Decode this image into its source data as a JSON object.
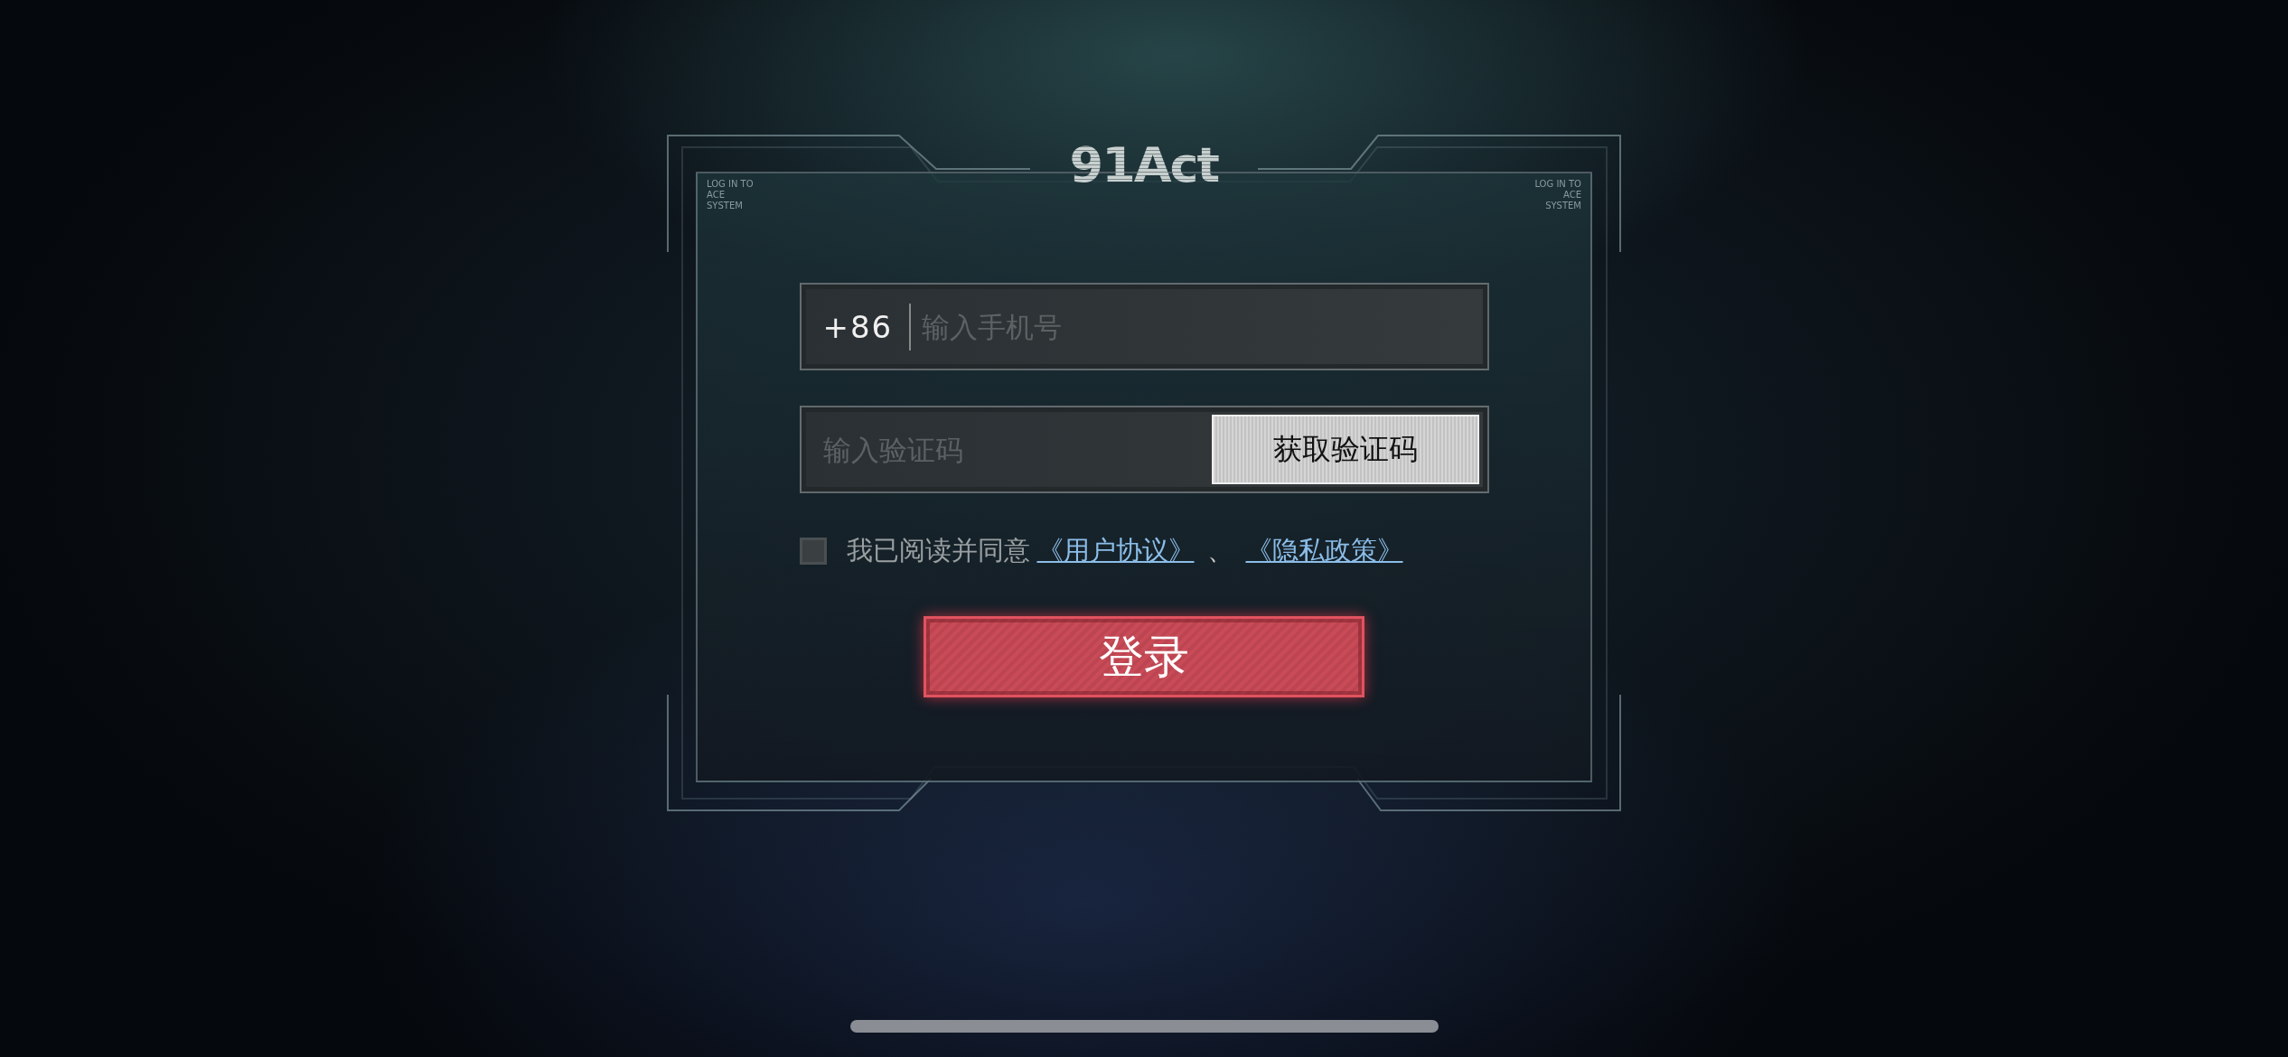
{
  "logo": "91Act",
  "corner_captions": [
    [
      "LOG IN TO",
      "ACE",
      "SYSTEM"
    ],
    [
      "LOG IN TO",
      "ACE",
      "SYSTEM"
    ]
  ],
  "phone_field": {
    "country_code": "+86",
    "placeholder": "输入手机号"
  },
  "code_field": {
    "placeholder": "输入验证码",
    "button": "获取验证码"
  },
  "agreement": {
    "checked": false,
    "text": "我已阅读并同意",
    "links": [
      "《用户协议》",
      "《隐私政策》"
    ],
    "separator": "、"
  },
  "login_button": "登录"
}
